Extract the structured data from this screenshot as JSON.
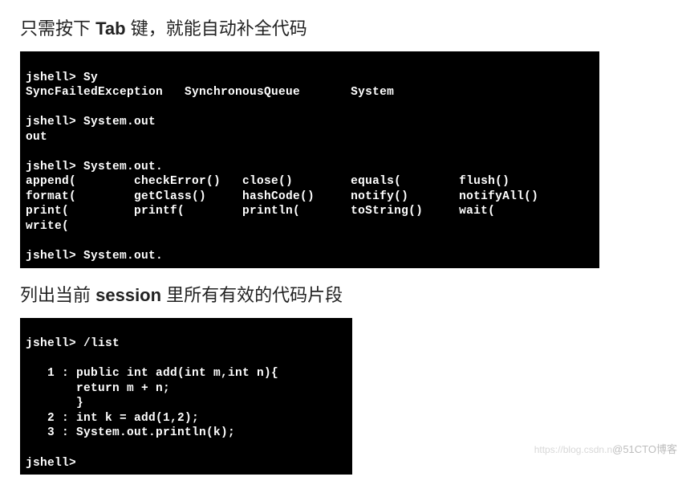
{
  "heading1": {
    "pre": "只需按下 ",
    "bold": "Tab",
    "post": " 键，就能自动补全代码"
  },
  "terminal1": {
    "l1": "jshell> Sy",
    "l2": "SyncFailedException   SynchronousQueue       System",
    "l3": "",
    "l4": "jshell> System.out",
    "l5": "out",
    "l6": "",
    "l7": "jshell> System.out.",
    "l8": "append(        checkError()   close()        equals(        flush()",
    "l9": "format(        getClass()     hashCode()     notify()       notifyAll()",
    "l10": "print(         printf(        println(       toString()     wait(",
    "l11": "write(",
    "l12": "",
    "l13": "jshell> System.out."
  },
  "heading2": {
    "pre": "列出当前 ",
    "bold": "session",
    "post": " 里所有有效的代码片段"
  },
  "terminal2": {
    "l1": "jshell> /list",
    "l2": "",
    "l3": "   1 : public int add(int m,int n){",
    "l4": "       return m + n;",
    "l5": "       }",
    "l6": "   2 : int k = add(1,2);",
    "l7": "   3 : System.out.println(k);",
    "l8": "",
    "l9": "jshell>"
  },
  "watermark": {
    "left": "https://blog.csdn.n",
    "right": "@51CTO博客"
  }
}
